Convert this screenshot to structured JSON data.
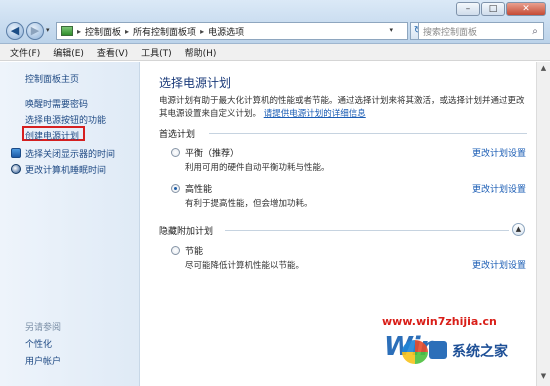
{
  "window": {
    "minimize": "–",
    "maximize": "□",
    "close": "✕"
  },
  "address_bar": {
    "breadcrumbs": [
      "控制面板",
      "所有控制面板项",
      "电源选项"
    ],
    "separator": "▸",
    "search_placeholder": "搜索控制面板"
  },
  "menubar": {
    "items": [
      "文件(F)",
      "编辑(E)",
      "查看(V)",
      "工具(T)",
      "帮助(H)"
    ]
  },
  "sidebar": {
    "home": "控制面板主页",
    "links": [
      "唤醒时需要密码",
      "选择电源按钮的功能",
      "创建电源计划",
      "选择关闭显示器的时间",
      "更改计算机睡眠时间"
    ],
    "see_also_label": "另请参阅",
    "see_also": [
      "个性化",
      "用户帐户"
    ]
  },
  "main": {
    "title": "选择电源计划",
    "description": "电源计划有助于最大化计算机的性能或者节能。通过选择计划来将其激活，或选择计划并通过更改其电源设置来自定义计划。",
    "description_link": "请提供电源计划的详细信息",
    "preferred_label": "首选计划",
    "hidden_label": "隐藏附加计划",
    "change_link": "更改计划设置",
    "plans": [
      {
        "name": "平衡（推荐）",
        "desc": "利用可用的硬件自动平衡功耗与性能。",
        "selected": false
      },
      {
        "name": "高性能",
        "desc": "有利于提高性能，但会增加功耗。",
        "selected": true
      },
      {
        "name": "节能",
        "desc": "尽可能降低计算机性能以节能。",
        "selected": false
      }
    ]
  },
  "watermark": {
    "url": "www.win7zhijia.cn",
    "logo": "Win",
    "text": "系统之家"
  },
  "colors": {
    "link": "#1a5cb4",
    "title": "#1a3a79",
    "highlight_box": "#d62020"
  }
}
